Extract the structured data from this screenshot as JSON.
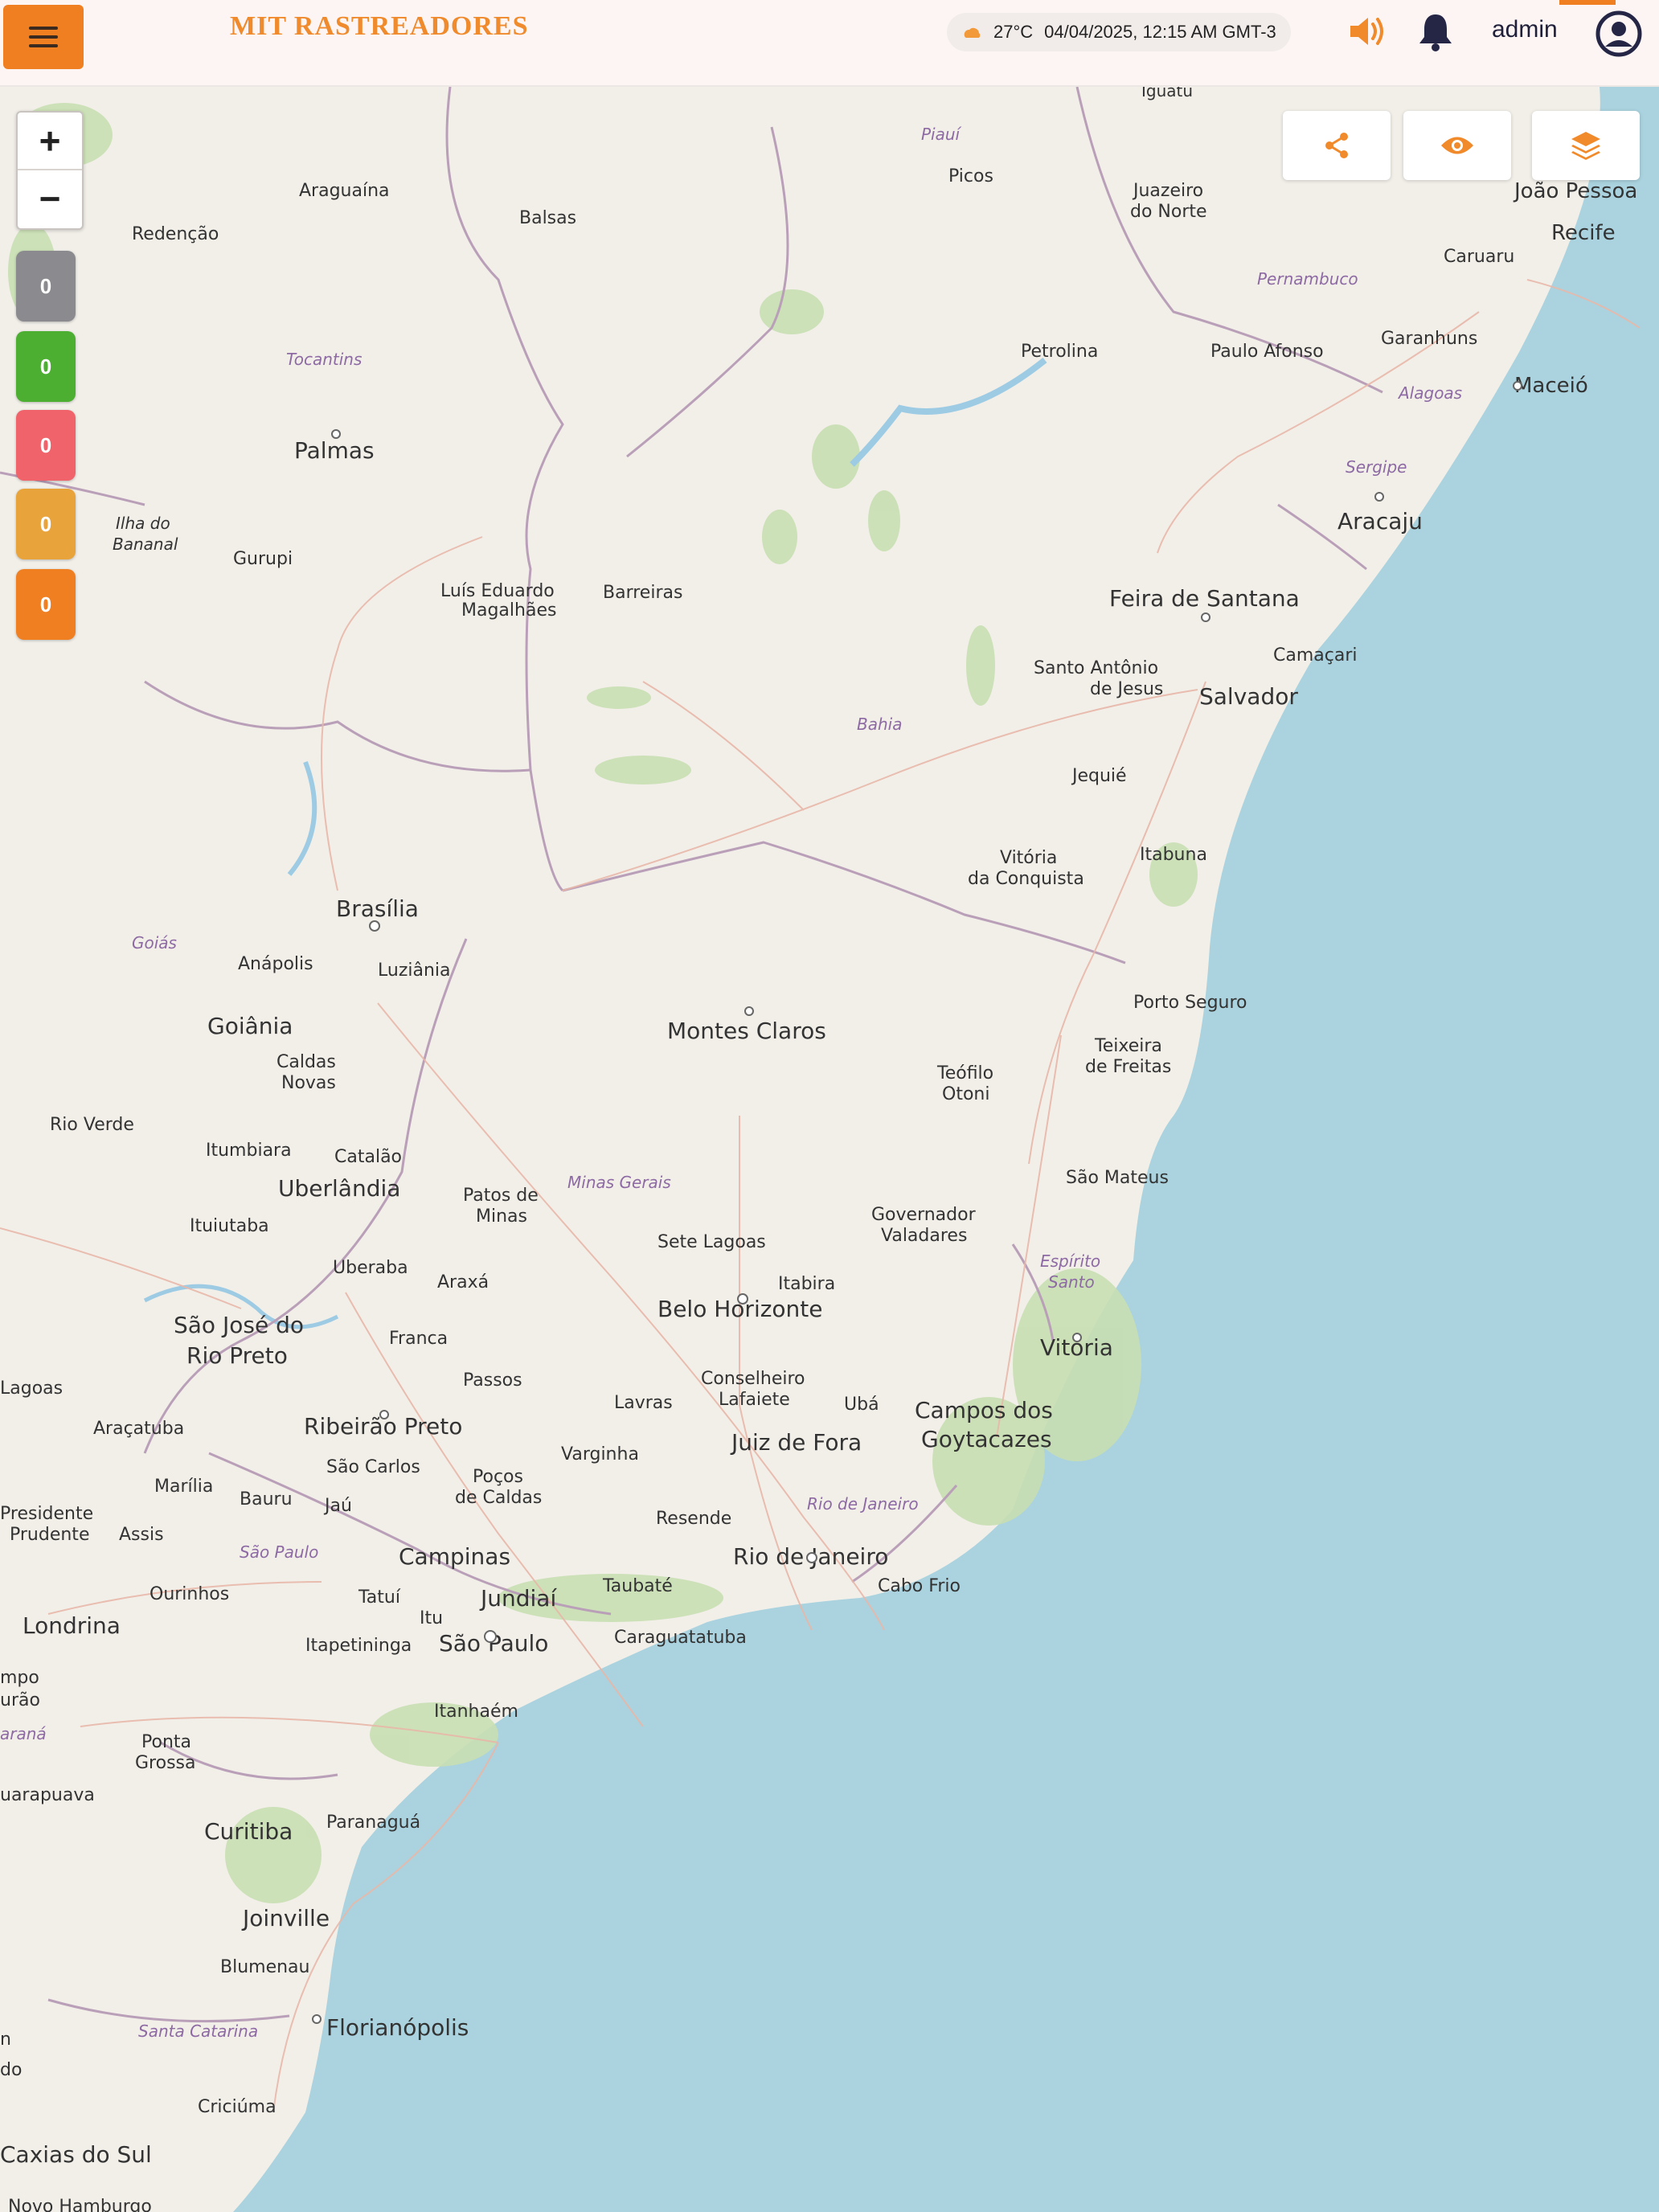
{
  "header": {
    "brand": "MIT RASTREADORES",
    "weather_temp": "27°C",
    "datetime": "04/04/2025, 12:15 AM GMT-3",
    "username": "admin"
  },
  "map_controls": {
    "zoom_in": "+",
    "zoom_out": "−"
  },
  "status_counters": [
    {
      "value": "0",
      "color": "#8a8a8f"
    },
    {
      "value": "0",
      "color": "#4caf32"
    },
    {
      "value": "0",
      "color": "#f0636a"
    },
    {
      "value": "0",
      "color": "#e8a33b"
    },
    {
      "value": "0",
      "color": "#f07f22"
    }
  ],
  "toolbar": [
    {
      "icon": "share-icon"
    },
    {
      "icon": "eye-icon"
    },
    {
      "icon": "layers-icon"
    }
  ],
  "map": {
    "places": [
      "Iguatu",
      "Piauí",
      "Picos",
      "Juazeiro do Norte",
      "João Pessoa",
      "Recife",
      "Caruaru",
      "Araguaína",
      "Balsas",
      "Redenção",
      "Pernambuco",
      "Petrolina",
      "Paulo Afonso",
      "Garanhuns",
      "Tocantins",
      "Alagoas",
      "Maceió",
      "Palmas",
      "Sergipe",
      "Aracaju",
      "Ilha do Bananal",
      "Gurupi",
      "Luís Eduardo Magalhães",
      "Barreiras",
      "Feira de Santana",
      "Camaçari",
      "Santo Antônio de Jesus",
      "Salvador",
      "Bahia",
      "Jequié",
      "Itabuna",
      "Vitória da Conquista",
      "Brasília",
      "Goiás",
      "Anápolis",
      "Luziânia",
      "Goiânia",
      "Montes Claros",
      "Porto Seguro",
      "Teixeira de Freitas",
      "Caldas Novas",
      "Teófilo Otoni",
      "Rio Verde",
      "Itumbiara",
      "Catalão",
      "São Mateus",
      "Uberlândia",
      "Patos de Minas",
      "Minas Gerais",
      "Governador Valadares",
      "Ituiutaba",
      "Sete Lagoas",
      "Espírito Santo",
      "Uberaba",
      "Araxá",
      "Itabira",
      "Belo Horizonte",
      "São José do Rio Preto",
      "Franca",
      "Vitória",
      "Lagoas",
      "Passos",
      "Conselheiro Lafaiete",
      "Lavras",
      "Ubá",
      "Campos dos Goytacazes",
      "Araçatuba",
      "Ribeirão Preto",
      "Juiz de Fora",
      "Varginha",
      "São Carlos",
      "Poços de Caldas",
      "Marília",
      "Bauru",
      "Jaú",
      "Rio de Janeiro",
      "Presidente Prudente",
      "Assis",
      "Resende",
      "São Paulo",
      "Campinas",
      "Tatuí",
      "Jundiaí",
      "Taubaté",
      "Cabo Frio",
      "Ourinhos",
      "Itu",
      "Londrina",
      "Itapetininga",
      "Caraguatatuba",
      "Itanhaém",
      "Ponta Grossa",
      "Guarapuava",
      "Curitiba",
      "Paranaguá",
      "Joinville",
      "Blumenau",
      "Santa Catarina",
      "Florianópolis",
      "Criciúma",
      "Caxias do Sul",
      "Novo Hamburgo",
      "Paraná"
    ]
  }
}
